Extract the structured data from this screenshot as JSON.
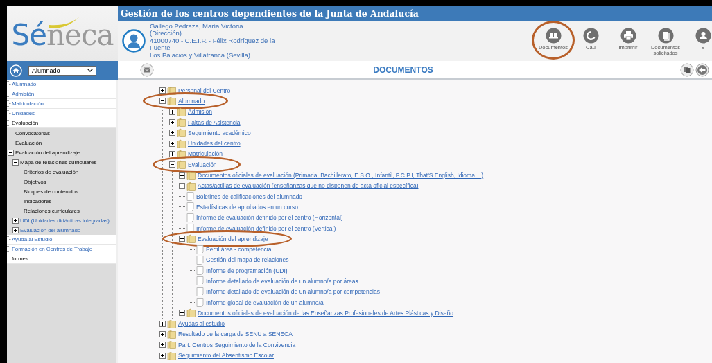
{
  "header": {
    "logo_lead": "Sé",
    "logo_rest": "neca",
    "title": "Gestión de los centros dependientes de la Junta de Andalucía",
    "user": [
      "Gallego Pedraza, María Victoria",
      "(Dirección)",
      "41000740 - C.E.I.P. - Félix Rodríguez de la Fuente",
      "Los Palacios y Villafranca (Sevilla)"
    ],
    "toolbar": [
      {
        "label": "Documentos",
        "highlighted": true
      },
      {
        "label": "Cau",
        "highlighted": false
      },
      {
        "label": "Imprimir",
        "highlighted": false
      },
      {
        "label": "Documentos solicitados",
        "highlighted": false
      },
      {
        "label": "S",
        "highlighted": false
      }
    ]
  },
  "module_select": {
    "value": "Alumnado"
  },
  "page_title": "DOCUMENTOS",
  "sidebar": {
    "items": [
      {
        "label": "Alumnado",
        "expanded": false
      },
      {
        "label": "Admisión",
        "expanded": false
      },
      {
        "label": "Matriculación",
        "expanded": false
      },
      {
        "label": "Unidades",
        "expanded": false
      },
      {
        "label": "Evaluación",
        "expanded": true,
        "children": [
          {
            "label": "Convocatorias"
          },
          {
            "label": "Evaluación"
          },
          {
            "label": "Evaluación del aprendizaje",
            "expanded": true,
            "children": [
              {
                "label": "Mapa de relaciones curriculares",
                "expanded": true,
                "children": [
                  {
                    "label": "Criterios de evaluación"
                  },
                  {
                    "label": "Objetivos"
                  },
                  {
                    "label": "Bloques de contenidos"
                  },
                  {
                    "label": "Indicadores"
                  },
                  {
                    "label": "Relaciones curriculares"
                  }
                ]
              },
              {
                "label": "UDI (Unidades didácticas integradas)",
                "expanded": false
              },
              {
                "label": "Evaluación del alumnado",
                "expanded": false
              }
            ]
          }
        ]
      },
      {
        "label": "Ayuda al Estudio",
        "expanded": false
      },
      {
        "label": "Formación en Centros de Trabajo",
        "expanded": false
      },
      {
        "label": "formes"
      }
    ]
  },
  "tree": [
    {
      "kind": "folder",
      "label": "Personal del Centro",
      "expanded": false,
      "highlighted": false
    },
    {
      "kind": "folder",
      "label": "Alumnado",
      "expanded": true,
      "highlighted": true,
      "children": [
        {
          "kind": "folder",
          "label": "Admisión",
          "expanded": false,
          "highlighted": false
        },
        {
          "kind": "folder",
          "label": "Faltas de Asistencia",
          "expanded": false,
          "highlighted": false
        },
        {
          "kind": "folder",
          "label": "Seguimiento académico",
          "expanded": false,
          "highlighted": false
        },
        {
          "kind": "folder",
          "label": "Unidades del centro",
          "expanded": false,
          "highlighted": false
        },
        {
          "kind": "folder",
          "label": "Matriculación",
          "expanded": false,
          "highlighted": false
        },
        {
          "kind": "folder",
          "label": "Evaluación",
          "expanded": true,
          "highlighted": true,
          "children": [
            {
              "kind": "folder",
              "label": "Documentos oficiales de evaluación (Primaria, Bachillerato, E.S.O., Infantil, P.C.P.I, That'S English, Idioma....)",
              "expanded": false,
              "highlighted": false
            },
            {
              "kind": "folder",
              "label": "Actas/actillas de evaluación (enseñanzas que no disponen de acta oficial específica)",
              "expanded": false,
              "highlighted": false
            },
            {
              "kind": "document",
              "label": "Boletines de calificaciones del alumnado",
              "highlighted": false
            },
            {
              "kind": "document",
              "label": "Estadísticas de aprobados en un curso",
              "highlighted": false
            },
            {
              "kind": "document",
              "label": "Informe de evaluación definido por el centro (Horizontal)",
              "highlighted": false
            },
            {
              "kind": "document",
              "label": "Informe de evaluación definido por el centro (Vertical)",
              "highlighted": false
            },
            {
              "kind": "folder",
              "label": "Evaluación del aprendizaje",
              "expanded": true,
              "highlighted": true,
              "children": [
                {
                  "kind": "document",
                  "label": "Perfil área - competencia",
                  "highlighted": false
                },
                {
                  "kind": "document",
                  "label": "Gestión del mapa de relaciones",
                  "highlighted": false
                },
                {
                  "kind": "document",
                  "label": "Informe de programación (UDI)",
                  "highlighted": false
                },
                {
                  "kind": "document",
                  "label": "Informe detallado de evaluación de un alumno/a por áreas",
                  "highlighted": false
                },
                {
                  "kind": "document",
                  "label": "Informe detallado de evaluación de un alumno/a por competencias",
                  "highlighted": false
                },
                {
                  "kind": "document",
                  "label": "Informe global de evaluación de un alumno/a",
                  "highlighted": false
                }
              ]
            },
            {
              "kind": "folder",
              "label": "Documentos oficiales de evaluación de las Enseñanzas Profesionales de Artes Plásticas y Diseño",
              "expanded": false,
              "highlighted": false
            }
          ]
        }
      ]
    },
    {
      "kind": "folder",
      "label": "Ayudas al estudio",
      "expanded": false,
      "highlighted": false
    },
    {
      "kind": "folder",
      "label": "Resultado de la carga de SENU a SENECA",
      "expanded": false,
      "highlighted": false
    },
    {
      "kind": "folder",
      "label": "Part. Centros Seguimiento de la Convivencia",
      "expanded": false,
      "highlighted": false
    },
    {
      "kind": "folder",
      "label": "Seguimiento del Absentismo Escolar",
      "expanded": false,
      "highlighted": false
    }
  ]
}
